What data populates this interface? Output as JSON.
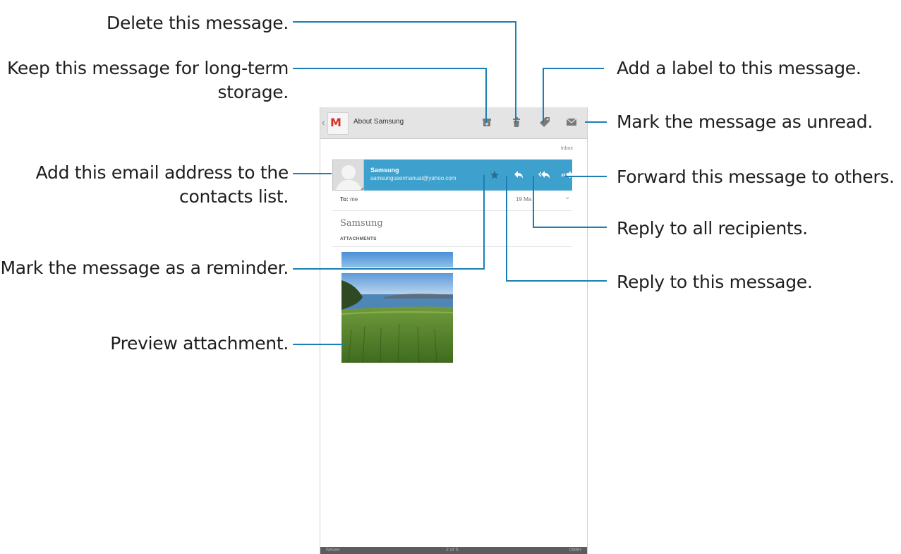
{
  "callouts": {
    "delete": "Delete this message.",
    "keep_line1": "Keep this message for long-term",
    "keep_line2": "storage.",
    "contact_line1": "Add this email address to the",
    "contact_line2": "contacts list.",
    "reminder": "Mark the message as a reminder.",
    "preview": "Preview attachment.",
    "label": "Add a label to this message.",
    "unread": "Mark the message as unread.",
    "forward": "Forward this message to others.",
    "reply_all": "Reply to all recipients.",
    "reply": "Reply to this message."
  },
  "app": {
    "logo_letter": "M",
    "subject": "About Samsung",
    "folder": "Inbox"
  },
  "toolbar": {
    "icons": [
      "archive-icon",
      "delete-icon",
      "label-icon",
      "mark-unread-icon"
    ]
  },
  "message": {
    "sender_name": "Samsung",
    "sender_email": "samsungusermanual@yahoo.com",
    "to_label": "To:",
    "to_value": "me",
    "date": "19 Ma",
    "body": "Samsung",
    "attachments_label": "ATTACHMENTS"
  },
  "footer": {
    "newer": "Newer",
    "pager": "2 of 5",
    "older": "Older"
  },
  "colors": {
    "sender_bar": "#3ea0cc",
    "leader_line": "#1a7fb5",
    "action_bar": "#e4e4e4"
  }
}
